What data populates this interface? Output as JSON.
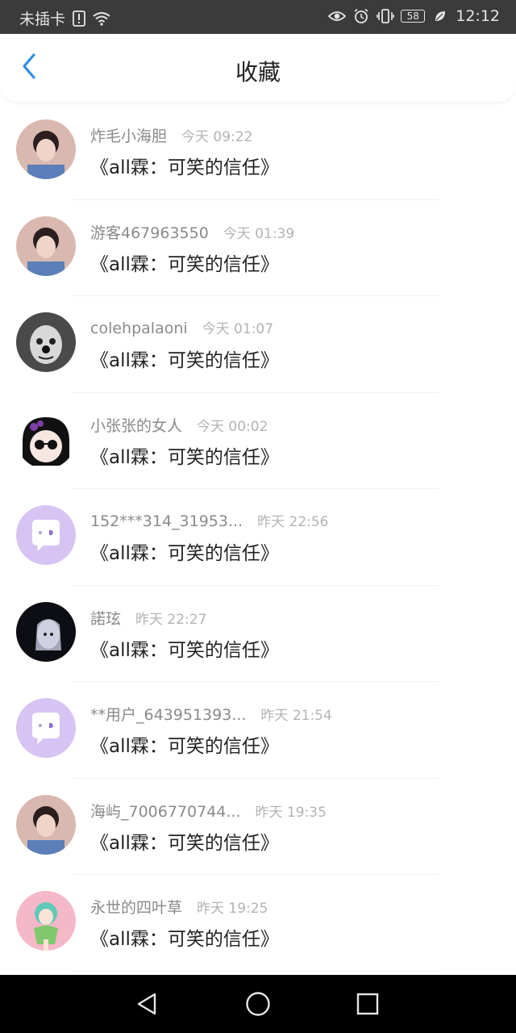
{
  "status_bar": {
    "carrier": "未插卡",
    "battery": "58",
    "time": "12:12",
    "icons": [
      "sim-alert-icon",
      "wifi-icon",
      "eye-icon",
      "alarm-icon",
      "vibrate-icon",
      "battery-icon",
      "leaf-icon"
    ]
  },
  "header": {
    "back_icon": "chevron-left-icon",
    "title": "收藏"
  },
  "favorites": [
    {
      "name": "炸毛小海胆",
      "time": "今天 09:22",
      "work": "《all霖：可笑的信任》",
      "avatar": "photo-avatar"
    },
    {
      "name": "游客467963550",
      "time": "今天 01:39",
      "work": "《all霖：可笑的信任》",
      "avatar": "photo-avatar"
    },
    {
      "name": "colehpalaoni",
      "time": "今天 01:07",
      "work": "《all霖：可笑的信任》",
      "avatar": "clown-avatar"
    },
    {
      "name": "小张张的女人",
      "time": "今天 00:02",
      "work": "《all霖：可笑的信任》",
      "avatar": "cartoon-avatar"
    },
    {
      "name": "152***314_31953...",
      "time": "昨天 22:56",
      "work": "《all霖：可笑的信任》",
      "avatar": "default-chat-avatar"
    },
    {
      "name": "諾玹",
      "time": "昨天 22:27",
      "work": "《all霖：可笑的信任》",
      "avatar": "dark-art-avatar"
    },
    {
      "name": "**用户_643951393...",
      "time": "昨天 21:54",
      "work": "《all霖：可笑的信任》",
      "avatar": "default-chat-avatar"
    },
    {
      "name": "海屿_7006770744...",
      "time": "昨天 19:35",
      "work": "《all霖：可笑的信任》",
      "avatar": "photo-avatar"
    },
    {
      "name": "永世的四叶草",
      "time": "昨天 19:25",
      "work": "《all霖：可笑的信任》",
      "avatar": "anime-avatar"
    }
  ],
  "nav": {
    "back": "nav-back-icon",
    "home": "nav-home-icon",
    "recent": "nav-recent-icon"
  },
  "colors": {
    "accent": "#2f8fe0",
    "default_avatar": "#d7c4f2",
    "status_bar": "#3b3b3b"
  }
}
